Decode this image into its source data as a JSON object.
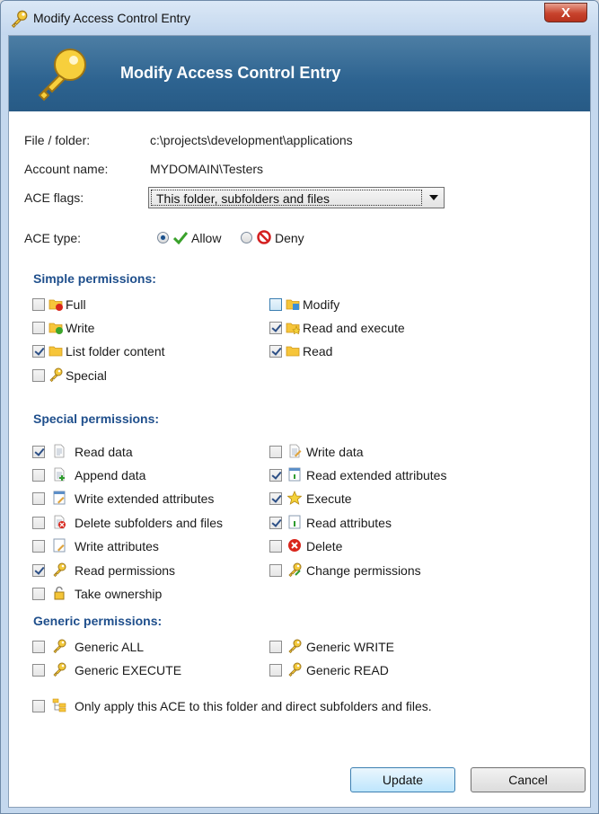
{
  "window": {
    "title": "Modify Access Control Entry",
    "close_glyph": "X"
  },
  "banner": {
    "title": "Modify Access Control Entry"
  },
  "fields": {
    "file_label": "File / folder:",
    "file_value": "c:\\projects\\development\\applications",
    "account_label": "Account name:",
    "account_value": "MYDOMAIN\\Testers",
    "flags_label": "ACE flags:",
    "flags_value": "This folder, subfolders and files",
    "type_label": "ACE type:",
    "allow_label": "Allow",
    "deny_label": "Deny",
    "ace_type_selected": "Allow"
  },
  "simple": {
    "heading": "Simple permissions:",
    "full": "Full",
    "modify": "Modify",
    "write": "Write",
    "read_execute": "Read and execute",
    "list_folder": "List folder content",
    "read": "Read",
    "special": "Special"
  },
  "special": {
    "heading": "Special permissions:",
    "read_data": "Read data",
    "write_data": "Write data",
    "append_data": "Append data",
    "read_ext_attr": "Read extended attributes",
    "write_ext_attr": "Write extended attributes",
    "execute": "Execute",
    "delete_sub": "Delete subfolders and files",
    "read_attr": "Read attributes",
    "write_attr": "Write attributes",
    "delete": "Delete",
    "read_perm": "Read permissions",
    "change_perm": "Change permissions",
    "take_own": "Take ownership"
  },
  "generic": {
    "heading": "Generic permissions:",
    "all": "Generic ALL",
    "write": "Generic WRITE",
    "execute": "Generic EXECUTE",
    "read": "Generic READ"
  },
  "only_apply": "Only apply this ACE to this folder and direct subfolders and files.",
  "buttons": {
    "update": "Update",
    "cancel": "Cancel"
  },
  "colors": {
    "banner": "#2d6390",
    "section_heading": "#1f4f8c",
    "close": "#c8432d"
  }
}
